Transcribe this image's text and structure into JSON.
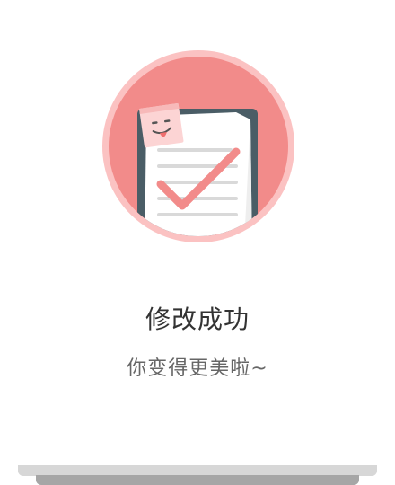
{
  "dialog": {
    "title": "修改成功",
    "subtitle": "你变得更美啦~"
  },
  "illustration": {
    "icon": "success-document-check-icon",
    "colors": {
      "circle_fill": "#f28b8a",
      "circle_ring": "#fbc2c2",
      "board": "#4a5d66",
      "paper": "#ffffff",
      "check": "#f28b8a",
      "sticky_note": "#fcd4d4",
      "tongue": "#f06f6f"
    }
  }
}
